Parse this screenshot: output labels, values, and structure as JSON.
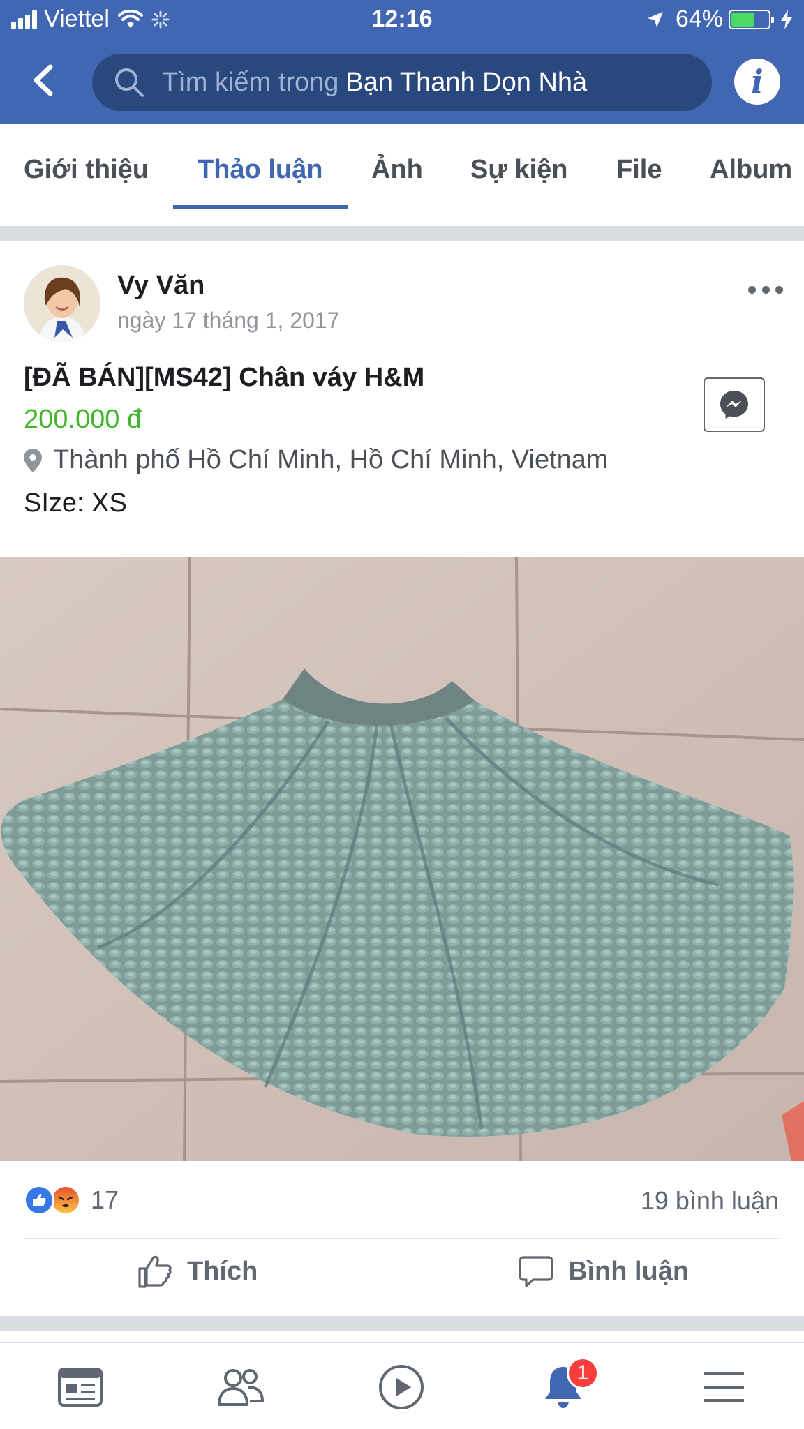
{
  "status_bar": {
    "carrier": "Viettel",
    "time": "12:16",
    "battery_percent": "64%",
    "battery_level": 0.64
  },
  "header": {
    "search_placeholder": "Tìm kiếm trong",
    "group_name": "Bạn Thanh Dọn Nhà",
    "back_icon": "back-chevron-icon",
    "info_icon": "info-icon",
    "accent_color": "#4267b2"
  },
  "tabs": [
    {
      "label": "Giới thiệu",
      "active": false
    },
    {
      "label": "Thảo luận",
      "active": true
    },
    {
      "label": "Ảnh",
      "active": false
    },
    {
      "label": "Sự kiện",
      "active": false
    },
    {
      "label": "File",
      "active": false
    },
    {
      "label": "Album",
      "active": false
    }
  ],
  "post": {
    "author": "Vy Văn",
    "timestamp": "ngày 17 tháng 1, 2017",
    "title": "[ĐÃ BÁN][MS42] Chân váy H&M",
    "price": "200.000 đ",
    "price_color": "#42b72a",
    "location": "Thành phố Hồ Chí Minh, Hồ Chí Minh, Vietnam",
    "size": "SIze: XS",
    "reaction_count": "17",
    "comment_count": "19 bình luận",
    "like_label": "Thích",
    "comment_label": "Bình luận"
  },
  "bottom_nav": {
    "items": [
      "news-feed-icon",
      "friends-icon",
      "watch-play-icon",
      "notifications-bell-icon",
      "menu-icon"
    ],
    "notification_badge": "1"
  }
}
